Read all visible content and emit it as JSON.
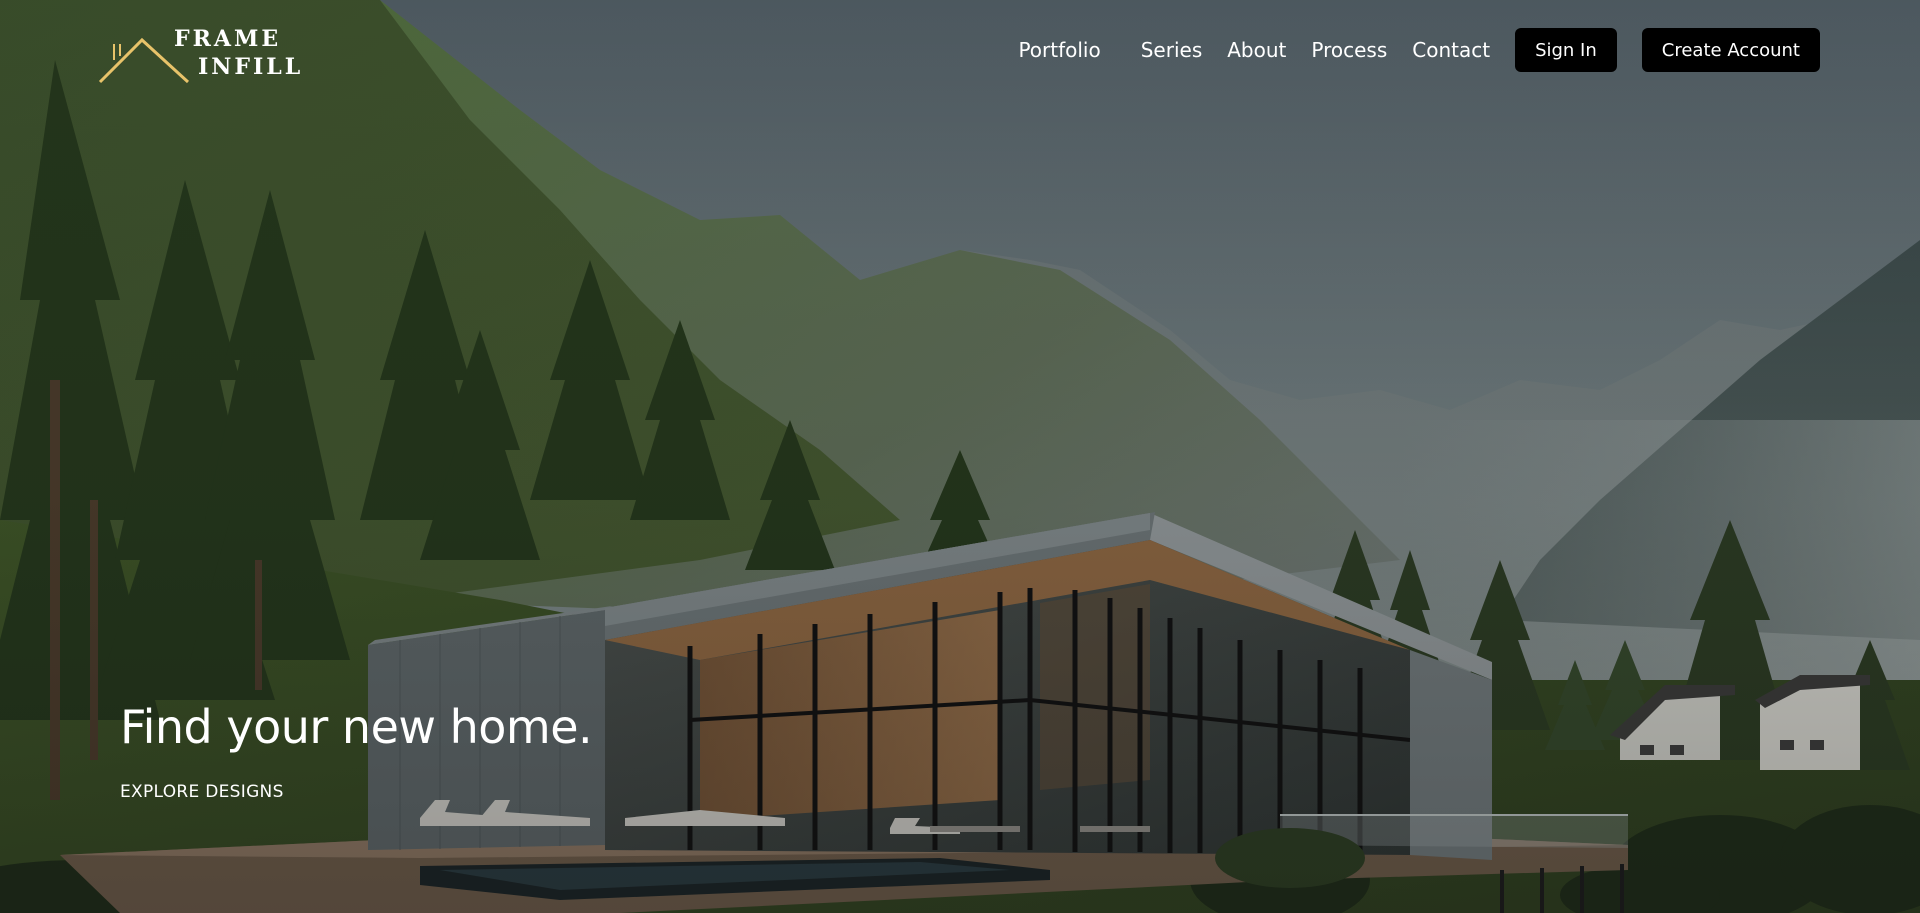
{
  "brand": {
    "line1": "FRAME",
    "line2": "INFILL",
    "accent_color": "#e8c36a"
  },
  "nav": {
    "links": [
      "Portfolio",
      "Series",
      "About",
      "Process",
      "Contact"
    ],
    "sign_in": "Sign In",
    "create_account": "Create Account"
  },
  "hero": {
    "headline": "Find your new home.",
    "cta": "EXPLORE DESIGNS"
  },
  "colors": {
    "button_bg": "#000000",
    "text": "#ffffff"
  }
}
